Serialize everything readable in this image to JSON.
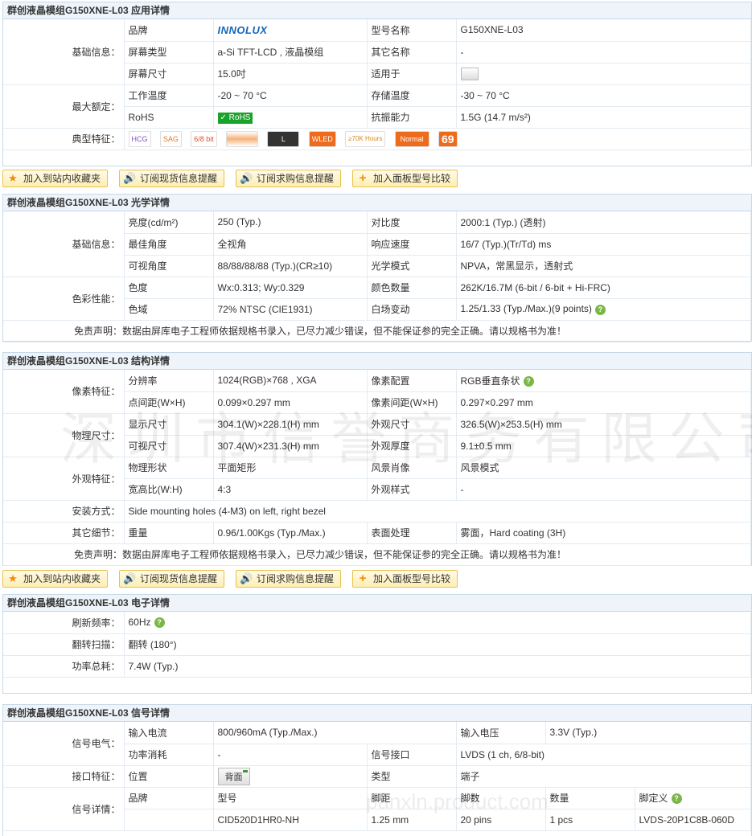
{
  "app": {
    "section_titles": {
      "app": "群创液晶模组G150XNE-L03 应用详情",
      "optical": "群创液晶模组G150XNE-L03 光学详情",
      "struct": "群创液晶模组G150XNE-L03 结构详情",
      "elec": "群创液晶模组G150XNE-L03 电子详情",
      "signal": "群创液晶模组G150XNE-L03 信号详情"
    },
    "watermark": "深圳市信誉商务有限公司",
    "watermark2": "panxln.product.com"
  },
  "toolbar": {
    "fav": "加入到站内收藏夹",
    "sub_stock": "订阅现货信息提醒",
    "sub_buy": "订阅求购信息提醒",
    "compare": "加入面板型号比较"
  },
  "appinfo": {
    "g_basic": "基础信息：",
    "g_rated": "最大额定：",
    "g_feature": "典型特征：",
    "brand_l": "品牌",
    "brand_v": "INNOLUX",
    "model_l": "型号名称",
    "model_v": "G150XNE-L03",
    "type_l": "屏幕类型",
    "type_v": "a-Si TFT-LCD , 液晶模组",
    "alias_l": "其它名称",
    "alias_v": "-",
    "size_l": "屏幕尺寸",
    "size_v": "15.0吋",
    "for_l": "适用于",
    "optemp_l": "工作温度",
    "optemp_v": "-20 ~ 70 °C",
    "sttemp_l": "存储温度",
    "sttemp_v": "-30 ~ 70 °C",
    "rohs_l": "RoHS",
    "rohs_v": "RoHS",
    "vib_l": "抗振能力",
    "vib_v": "1.5G (14.7 m/s²)",
    "features": [
      "HCG",
      "SAG",
      "6/8 bit",
      "",
      "L",
      "WLED",
      "≥70K Hours",
      "Normal",
      "69"
    ]
  },
  "optical": {
    "g_basic": "基础信息：",
    "g_color": "色彩性能：",
    "lum_l": "亮度(cd/m²)",
    "lum_v": "250 (Typ.)",
    "cr_l": "对比度",
    "cr_v": "2000:1 (Typ.) (透射)",
    "best_l": "最佳角度",
    "best_v": "全视角",
    "resp_l": "响应速度",
    "resp_v": "16/7 (Typ.)(Tr/Td) ms",
    "view_l": "可视角度",
    "view_v": "88/88/88/88 (Typ.)(CR≥10)",
    "mode_l": "光学模式",
    "mode_v": "NPVA，常黑显示，透射式",
    "chrom_l": "色度",
    "chrom_v": "Wx:0.313; Wy:0.329",
    "colors_l": "颜色数量",
    "colors_v": "262K/16.7M (6-bit / 6-bit + Hi-FRC)",
    "gamut_l": "色域",
    "gamut_v": "72% NTSC (CIE1931)",
    "white_l": "白场变动",
    "white_v": "1.25/1.33 (Typ./Max.)(9 points)",
    "disclaimer": "免责声明：数据由屏库电子工程师依据规格书录入，已尽力减少错误，但不能保证参的完全正确。请以规格书为准！"
  },
  "struct": {
    "g_pixel": "像素特征：",
    "g_phys": "物理尺寸：",
    "g_look": "外观特征：",
    "g_mount": "安装方式：",
    "g_other": "其它细节：",
    "res_l": "分辨率",
    "res_v": "1024(RGB)×768 , XGA",
    "pixcfg_l": "像素配置",
    "pixcfg_v": "RGB垂直条状",
    "pitch_l": "点间距(W×H)",
    "pitch_v": "0.099×0.297 mm",
    "pixpitch_l": "像素间距(W×H)",
    "pixpitch_v": "0.297×0.297 mm",
    "disp_l": "显示尺寸",
    "disp_v": "304.1(W)×228.1(H) mm",
    "outline_l": "外观尺寸",
    "outline_v": "326.5(W)×253.5(H) mm",
    "act_l": "可视尺寸",
    "act_v": "307.4(W)×231.3(H) mm",
    "thick_l": "外观厚度",
    "thick_v": "9.1±0.5 mm",
    "shape_l": "物理形状",
    "shape_v": "平面矩形",
    "orient_l": "风景肖像",
    "orient_v": "风景模式",
    "ratio_l": "宽高比(W:H)",
    "ratio_v": "4:3",
    "style_l": "外观样式",
    "style_v": "-",
    "mount_v": "Side mounting holes (4-M3) on left, right bezel",
    "weight_l": "重量",
    "weight_v": "0.96/1.00Kgs (Typ./Max.)",
    "surf_l": "表面处理",
    "surf_v": "雾面，Hard coating (3H)",
    "disclaimer": "免责声明：数据由屏库电子工程师依据规格书录入，已尽力减少错误，但不能保证参的完全正确。请以规格书为准！"
  },
  "elec": {
    "refresh_l": "刷新频率：",
    "refresh_v": "60Hz",
    "scan_l": "翻转扫描：",
    "scan_v": "翻转 (180°)",
    "power_l": "功率总耗：",
    "power_v": "7.4W (Typ.)"
  },
  "signal": {
    "g_elec": "信号电气：",
    "g_conn": "接口特征：",
    "g_detail": "信号详情：",
    "cur_l": "输入电流",
    "cur_v": "800/960mA (Typ./Max.)",
    "volt_l": "输入电压",
    "volt_v": "3.3V (Typ.)",
    "pw_l": "功率消耗",
    "pw_v": "-",
    "iface_l": "信号接口",
    "iface_v": "LVDS (1 ch, 6/8-bit)",
    "pos_l": "位置",
    "pos_v": "背面",
    "kind_l": "类型",
    "kind_v": "端子",
    "h_brand": "品牌",
    "h_model": "型号",
    "h_pitch": "脚距",
    "h_pins": "脚数",
    "h_qty": "数量",
    "h_def": "脚定义",
    "d_brand": "",
    "d_model": "CID520D1HR0-NH",
    "d_pitch": "1.25 mm",
    "d_pins": "20 pins",
    "d_qty": "1 pcs",
    "d_def": "LVDS-20P1C8B-060D"
  }
}
